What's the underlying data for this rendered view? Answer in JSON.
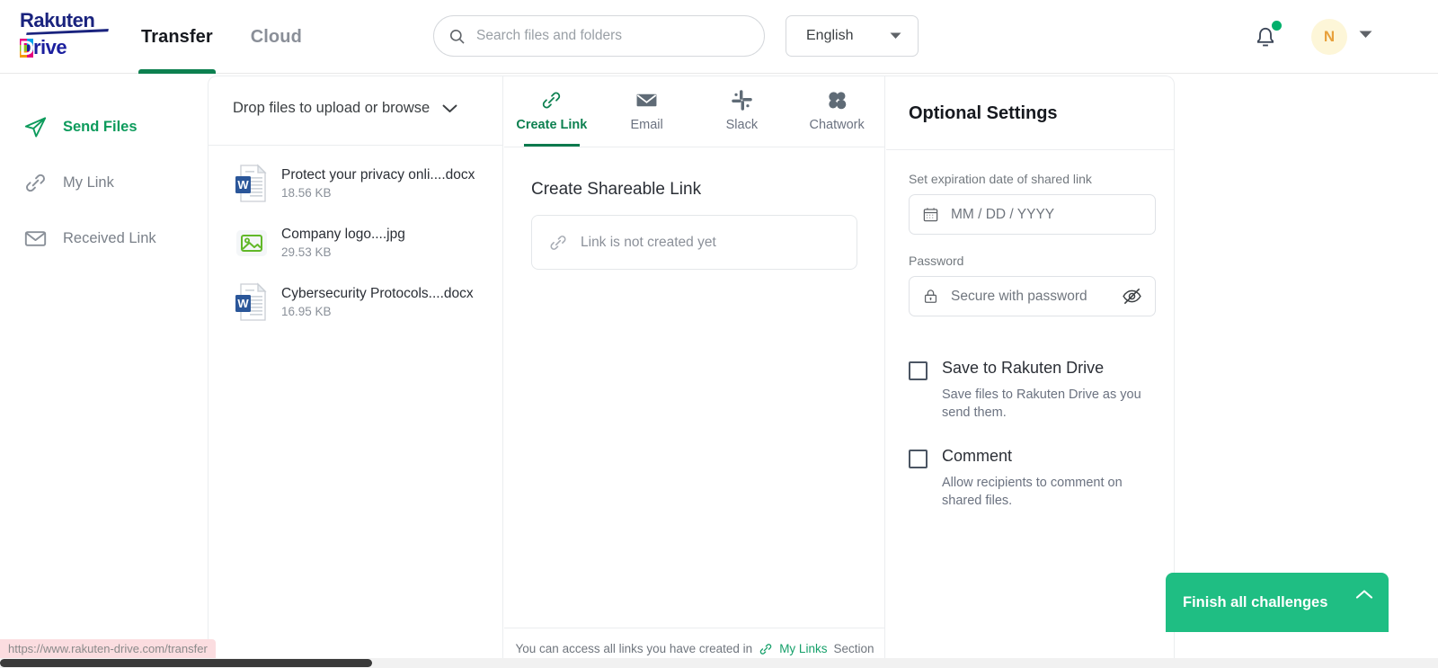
{
  "header": {
    "logo": {
      "line1": "Rakuten",
      "line2_initial": "D",
      "line2_rest": "rive"
    },
    "nav": [
      {
        "label": "Transfer",
        "active": true
      },
      {
        "label": "Cloud",
        "active": false
      }
    ],
    "search": {
      "placeholder": "Search files and folders",
      "value": "",
      "icon": "search-icon"
    },
    "language": {
      "selected": "English",
      "icon": "chevron-down-icon"
    },
    "notification": {
      "icon": "bell-icon",
      "has_unread": true,
      "dot_color": "#00b06b"
    },
    "avatar": {
      "initial": "N",
      "bg_color": "#fdf6d8",
      "text_color": "#e8a13c"
    }
  },
  "sidebar": {
    "items": [
      {
        "label": "Send Files",
        "icon": "send-plane-icon",
        "active": true
      },
      {
        "label": "My Link",
        "icon": "link-icon",
        "active": false
      },
      {
        "label": "Received Link",
        "icon": "envelope-icon",
        "active": false
      }
    ]
  },
  "files_panel": {
    "drop_header": "Drop files to upload or browse",
    "drop_icon": "chevron-down-icon",
    "files": [
      {
        "name": "Protect your privacy onli....docx",
        "size": "18.56 KB",
        "icon": "word-doc-icon"
      },
      {
        "name": "Company logo....jpg",
        "size": "29.53 KB",
        "icon": "image-file-icon"
      },
      {
        "name": "Cybersecurity Protocols....docx",
        "size": "16.95 KB",
        "icon": "word-doc-icon"
      }
    ]
  },
  "share_panel": {
    "tabs": [
      {
        "label": "Create Link",
        "icon": "link-icon",
        "active": true
      },
      {
        "label": "Email",
        "icon": "envelope-icon",
        "active": false
      },
      {
        "label": "Slack",
        "icon": "slack-icon",
        "active": false
      },
      {
        "label": "Chatwork",
        "icon": "chatwork-icon",
        "active": false
      }
    ],
    "title": "Create Shareable Link",
    "link_placeholder": "Link is not created yet",
    "link_icon": "link-icon",
    "footer_text": "You can access all links you have created in",
    "footer_link": "My Links",
    "footer_suffix": "Section",
    "footer_icon": "link-icon"
  },
  "optional_settings": {
    "title": "Optional Settings",
    "expiration": {
      "label": "Set expiration date of shared link",
      "placeholder": "MM / DD / YYYY",
      "value": "",
      "icon": "calendar-icon"
    },
    "password": {
      "label": "Password",
      "placeholder": "Secure with password",
      "value": "",
      "icon": "lock-icon",
      "toggle_icon": "eye-off-icon"
    },
    "checkboxes": [
      {
        "title": "Save to Rakuten Drive",
        "description": "Save files to Rakuten Drive as you send them.",
        "checked": false
      },
      {
        "title": "Comment",
        "description": "Allow recipients to comment on shared files.",
        "checked": false
      }
    ]
  },
  "challenge_widget": {
    "label": "Finish all challenges",
    "icon": "chevron-up-icon",
    "bg_color": "#1fbe83"
  },
  "status_bar": {
    "url": "https://www.rakuten-drive.com/transfer"
  },
  "colors": {
    "accent_green": "#0d8050",
    "brand_blue": "#1a237e",
    "link_green": "#16a06a"
  }
}
